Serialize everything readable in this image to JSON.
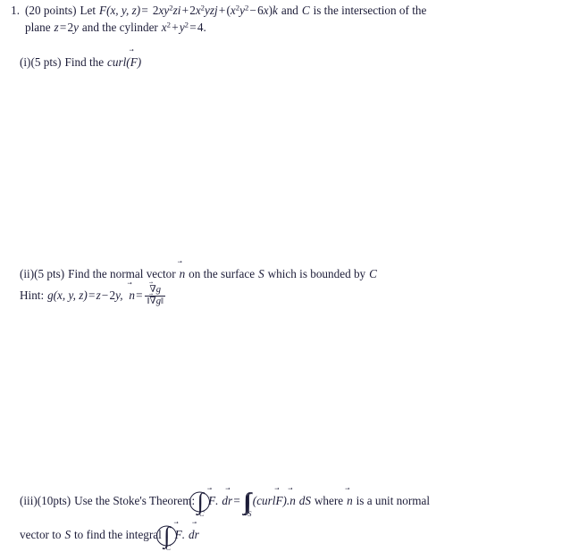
{
  "document": {
    "type": "math-problem-sheet",
    "background_color": "#ffffff",
    "text_color": "#1c1c38"
  },
  "problem": {
    "number": "1.",
    "points_label": "(20 points)",
    "stem": {
      "lead": "Let",
      "field_symbol": "F",
      "field_args": "(x, y, z)",
      "equals": "=",
      "term1_coef": "2",
      "term1_x": "x",
      "term1_y": "y",
      "term1_y_exp": "2",
      "term1_z": "z",
      "term1_unit": "i",
      "plus1": "+",
      "term2_coef": "2",
      "term2_x": "x",
      "term2_x_exp": "2",
      "term2_y": "y",
      "term2_z": "z",
      "term2_unit": "j",
      "plus2": "+",
      "term3_open": "(",
      "term3_x": "x",
      "term3_x_exp": "2",
      "term3_y": "y",
      "term3_y_exp": "2",
      "term3_minus": "−",
      "term3_coef": "6",
      "term3_var": "x",
      "term3_close": ")",
      "term3_unit": "k",
      "tail": "and",
      "curve_symbol": "C",
      "tail2": "is the intersection of the",
      "line2_lead": "plane",
      "plane_z": "z",
      "plane_eq": "=",
      "plane_rhs_coef": "2",
      "plane_rhs_var": "y",
      "line2_mid": "and the cylinder",
      "cyl_x": "x",
      "cyl_x_exp": "2",
      "cyl_plus": "+",
      "cyl_y": "y",
      "cyl_y_exp": "2",
      "cyl_eq": "=",
      "cyl_rhs": "4."
    }
  },
  "parts": [
    {
      "id": "i",
      "marker": "(i)",
      "points": "(5 pts)",
      "prompt": "Find the",
      "operator": "curl",
      "open_paren": "(",
      "arg_symbol": "F",
      "close_paren": ")"
    },
    {
      "id": "ii",
      "marker": "(ii)",
      "points": "(5 pts)",
      "prompt_a": "Find the normal vector",
      "normal_symbol": "n",
      "prompt_b": "on the surface",
      "surface_symbol": "S",
      "prompt_c": "which is bounded by",
      "curve_symbol": "C",
      "hint_label": "Hint:",
      "hint_g": "g",
      "hint_g_args": "(x, y, z)",
      "hint_eq1": "=",
      "hint_z": "z",
      "hint_minus": "−",
      "hint_coef": "2",
      "hint_y": "y,",
      "hint_n": "n",
      "hint_eq2": "=",
      "frac_num_nabla": "∇",
      "frac_num_g": "g",
      "frac_den_open": "‖",
      "frac_den_nabla": "∇",
      "frac_den_g": "g",
      "frac_den_close": "‖"
    },
    {
      "id": "iii",
      "marker": "(iii)",
      "points": "(10pts)",
      "prompt_a": "Use the Stoke's Theorem:",
      "oint_sub": "C",
      "oint_integrand_F": "F",
      "oint_dot": ".",
      "oint_d": "d",
      "oint_r": "r",
      "equals": "=",
      "double_int_sub": "S",
      "curl_open": "(",
      "curl_op": "curl",
      "curl_arg": "F",
      "curl_close": ")",
      "curl_dot": ".",
      "curl_n": "n",
      "curl_dS_d": "d",
      "curl_dS_S": "S",
      "prompt_b": "where",
      "unit_normal_symbol": "n",
      "prompt_c": "is a unit normal",
      "line2_a": "vector to",
      "line2_surface": "S",
      "line2_b": "to find the integral",
      "line2_oint_sub": "C",
      "line2_F": "F",
      "line2_dot": ".",
      "line2_d": "d",
      "line2_r": "r"
    }
  ],
  "glyphs": {
    "vector_arrow": "⃗",
    "integral": "∫",
    "nabla": "∇",
    "norm_bar": "‖"
  }
}
